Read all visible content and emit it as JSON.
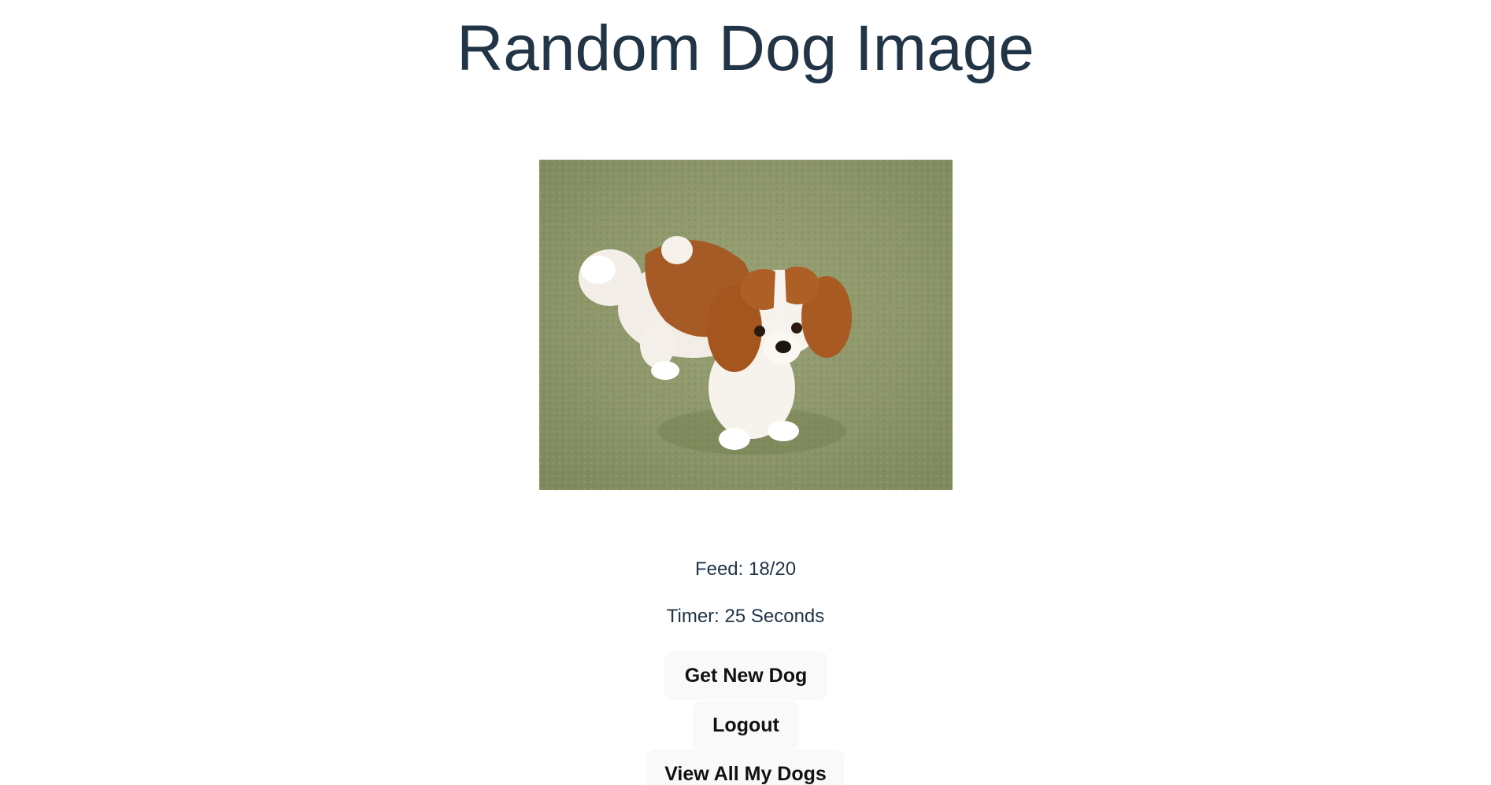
{
  "header": {
    "title": "Random Dog Image"
  },
  "dog_image": {
    "icon": "dog-photo",
    "subject": "Cavalier King Charles Spaniel on grass"
  },
  "status": {
    "feed": "Feed: 18/20",
    "timer": "Timer: 25 Seconds"
  },
  "actions": {
    "get_new_dog": "Get New Dog",
    "logout": "Logout",
    "view_all": "View All My Dogs"
  },
  "colors": {
    "title": "#213547",
    "button_bg": "#f9f9f9",
    "text": "#213547"
  }
}
